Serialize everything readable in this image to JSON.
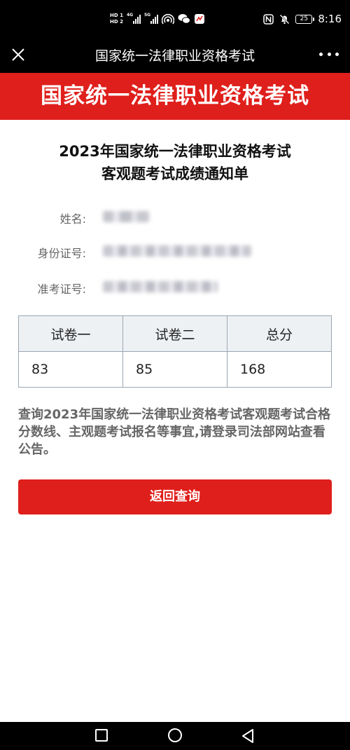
{
  "status_bar": {
    "hd1": "HD 1",
    "hd2": "HD 2",
    "network_1": "4G",
    "network_2": "5G",
    "time": "8:16",
    "battery": "25"
  },
  "app_bar": {
    "title": "国家统一法律职业资格考试"
  },
  "banner": {
    "text": "国家统一法律职业资格考试"
  },
  "heading": {
    "line1": "2023年国家统一法律职业资格考试",
    "line2": "客观题考试成绩通知单"
  },
  "info": {
    "name_label": "姓名:",
    "id_label": "身份证号:",
    "ticket_label": "准考证号:"
  },
  "scores": {
    "headers": [
      "试卷一",
      "试卷二",
      "总分"
    ],
    "values": [
      "83",
      "85",
      "168"
    ]
  },
  "notice": "查询2023年国家统一法律职业资格考试客观题考试合格分数线、主观题考试报名等事宜,请登录司法部网站查看公告。",
  "back_button": "返回查询",
  "colors": {
    "brand_red": "#df1f1b",
    "table_header_bg": "#eef1f4",
    "table_border": "#9aa7b3"
  }
}
